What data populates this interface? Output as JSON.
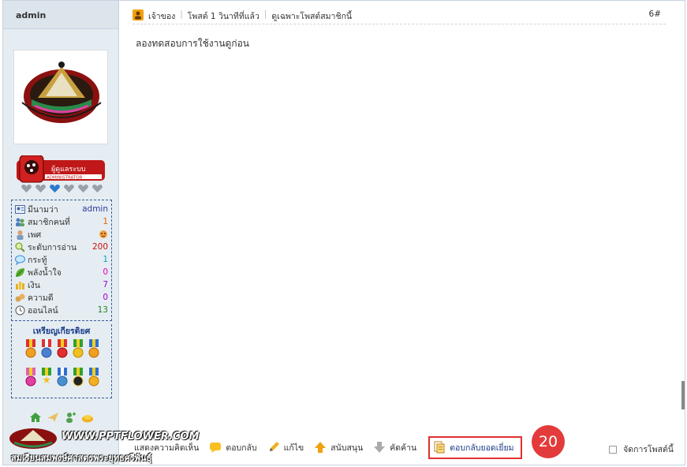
{
  "sidebar": {
    "username": "admin",
    "rank_badge_text": "ผู้ดูแลระบบ",
    "rank_badge_sub": "ADMINISTRATOR",
    "stats": [
      {
        "label": "มีนามว่า",
        "value": "admin",
        "color": "#2a3a9a",
        "icon": "user-card-icon"
      },
      {
        "label": "สมาชิกคนที่",
        "value": "1",
        "color": "#e06000",
        "icon": "members-icon"
      },
      {
        "label": "เพศ",
        "value": "",
        "color": "#e06000",
        "icon": "gender-icon"
      },
      {
        "label": "ระดับการอ่าน",
        "value": "200",
        "color": "#d01010",
        "icon": "search-level-icon"
      },
      {
        "label": "กระทู้",
        "value": "1",
        "color": "#10a0c0",
        "icon": "speech-bubble-icon"
      },
      {
        "label": "พลังน้ำใจ",
        "value": "0",
        "color": "#e000c0",
        "icon": "leaf-icon"
      },
      {
        "label": "เงิน",
        "value": "7",
        "color": "#a000d0",
        "icon": "money-icon"
      },
      {
        "label": "ความดี",
        "value": "0",
        "color": "#a000d0",
        "icon": "goodness-icon"
      },
      {
        "label": "ออนไลน์",
        "value": "13",
        "color": "#208020",
        "icon": "clock-icon"
      }
    ],
    "medals_title": "เหรียญเกียรติยศ",
    "watermark_line1": "WWW.PPTFLOWER.COM",
    "watermark_line2": "สมเรียนสมพงษ์ศาสตรพระยุทธศรีพันธุ์"
  },
  "post": {
    "owner_label": "เจ้าของ",
    "posted_label": "โพสต์ 1 วินาทีที่แล้ว",
    "only_member_label": "ดูเฉพาะโพสต์สมาชิกนี้",
    "post_number": "6#",
    "body": "ลองทดสอบการใช้งานดูก่อน"
  },
  "footer": {
    "comment_label": "แสดงความคิดเห็น",
    "reply_label": "ตอบกลับ",
    "edit_label": "แก้ไข",
    "support_label": "สนับสนุน",
    "oppose_label": "คัดค้าน",
    "best_reply_label": "ตอบกลับยอดเยี่ยม",
    "manage_label": "จัดการโพสต์นี้"
  },
  "annotation": {
    "badge_number": "20"
  },
  "colors": {
    "highlight_border": "#e03030",
    "badge_bg": "#e33b3b",
    "sidebar_bg": "#e5edf2"
  }
}
